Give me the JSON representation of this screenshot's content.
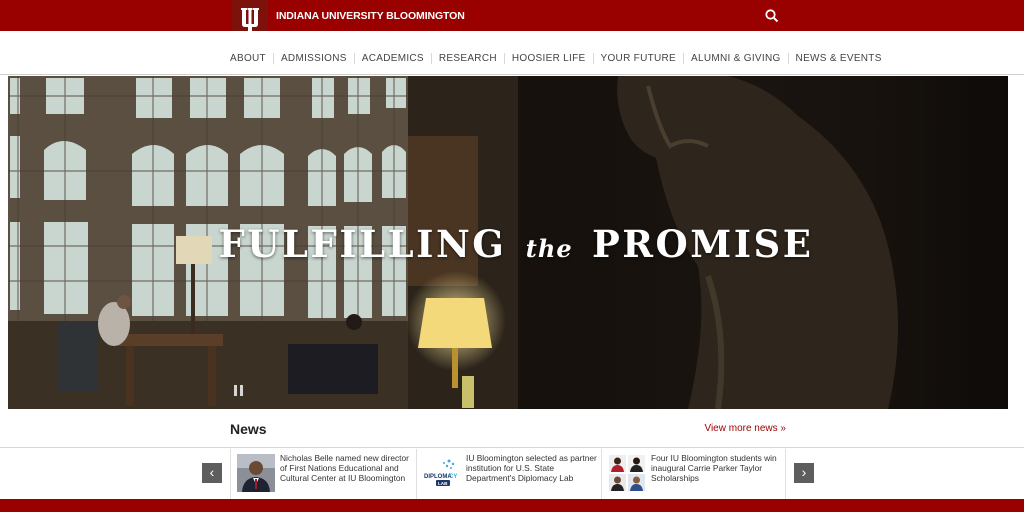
{
  "header": {
    "brand": "INDIANA UNIVERSITY BLOOMINGTON",
    "logo_icon": "iu-trident-icon",
    "search_icon": "search-icon",
    "colors": {
      "crimson": "#990000",
      "logo_bg": "#7d110c"
    }
  },
  "nav": {
    "items": [
      {
        "label": "ABOUT"
      },
      {
        "label": "ADMISSIONS"
      },
      {
        "label": "ACADEMICS"
      },
      {
        "label": "RESEARCH"
      },
      {
        "label": "HOOSIER LIFE"
      },
      {
        "label": "YOUR FUTURE"
      },
      {
        "label": "ALUMNI & GIVING"
      },
      {
        "label": "NEWS & EVENTS"
      }
    ]
  },
  "hero": {
    "title_pre": "FULFILLING",
    "title_mid": "the",
    "title_post": "PROMISE",
    "pause_icon": "pause-icon"
  },
  "news": {
    "heading": "News",
    "view_more": "View more news »",
    "prev_icon": "chevron-left-icon",
    "next_icon": "chevron-right-icon",
    "items": [
      {
        "text": "Nicholas Belle named new director of First Nations Educational and Cultural Center at IU Bloomington"
      },
      {
        "text": "IU Bloomington selected as partner institution for U.S. State Department's Diplomacy Lab"
      },
      {
        "text": "Four IU Bloomington students win inaugural Carrie Parker Taylor Scholarships"
      }
    ],
    "diplomacy_logo": "DIPLOMACY LAB"
  }
}
